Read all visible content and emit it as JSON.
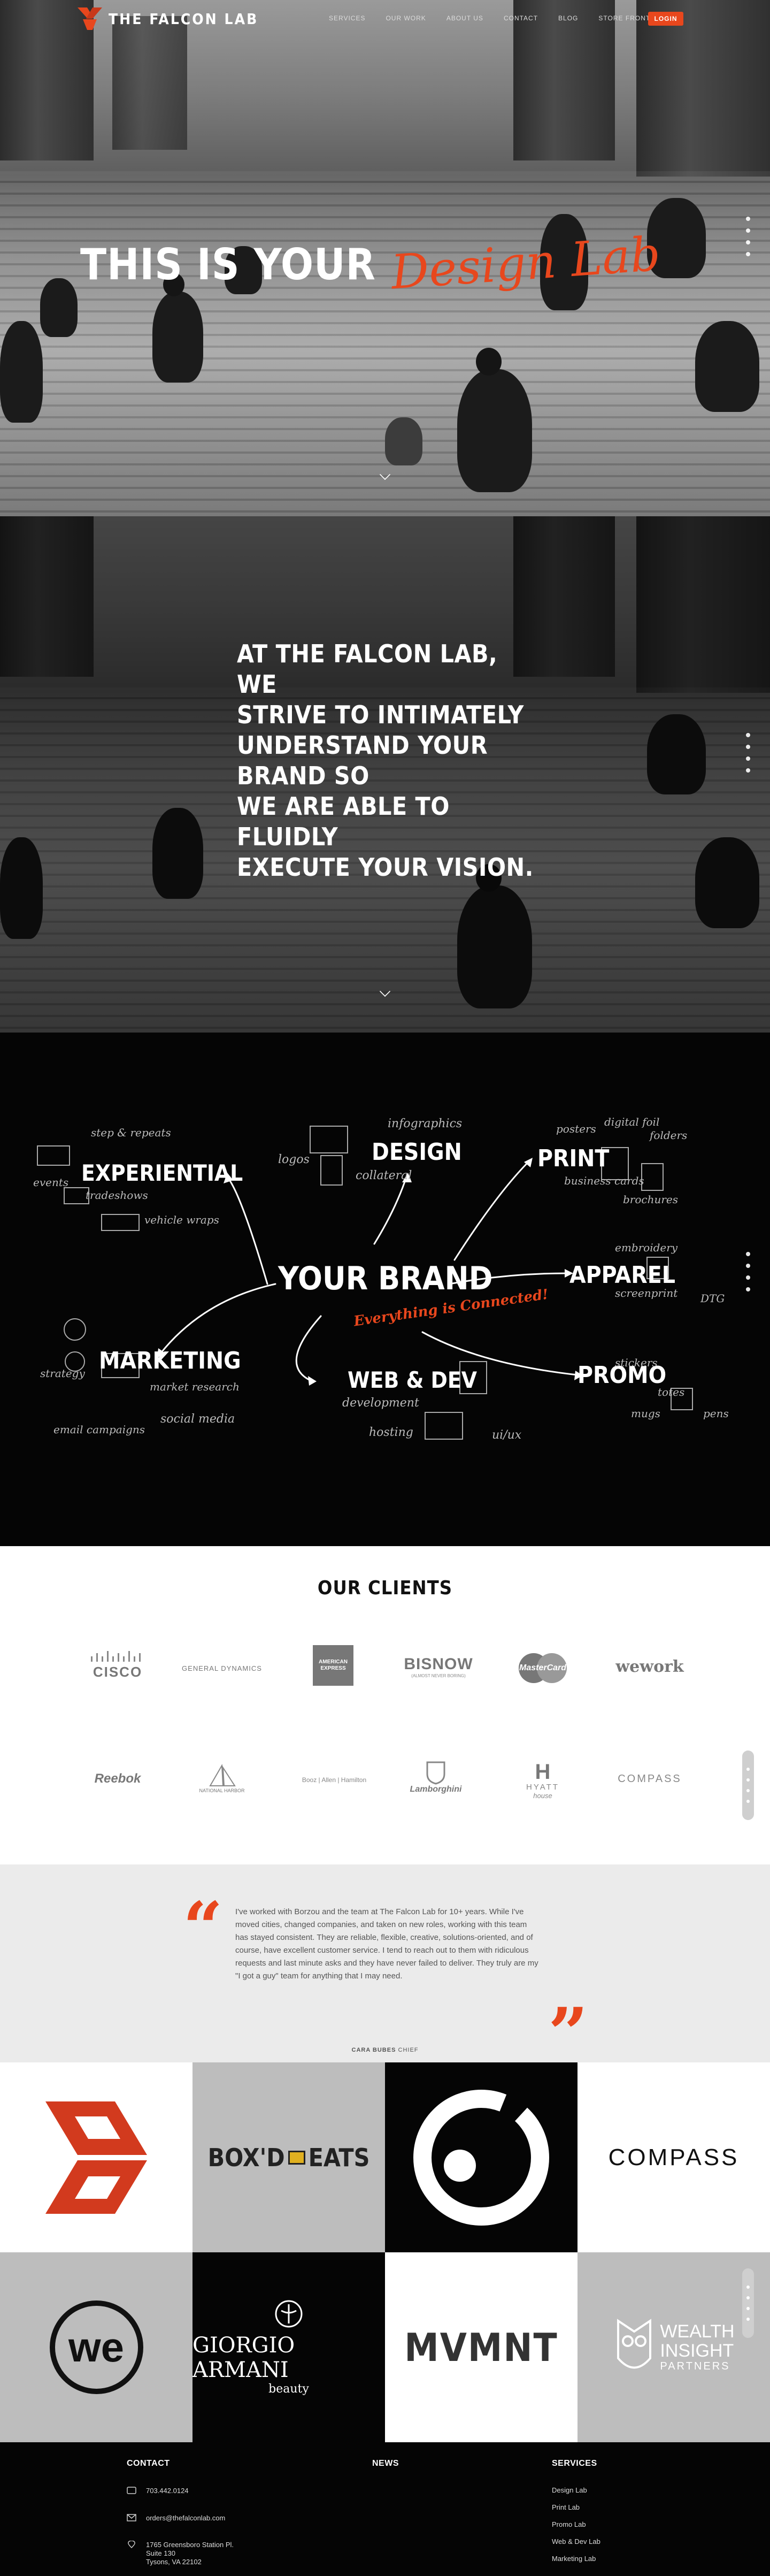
{
  "nav": {
    "logo_text": "THE FALCON LAB",
    "links": [
      "SERVICES",
      "OUR WORK",
      "ABOUT US",
      "CONTACT",
      "BLOG",
      "STORE FRONT"
    ],
    "login": "LOGIN",
    "accent": "#e8471d"
  },
  "hero": {
    "title_plain": "THIS IS YOUR",
    "title_script": "Design Lab"
  },
  "mission": {
    "lines": [
      "AT THE FALCON LAB, WE",
      "STRIVE TO INTIMATELY",
      "UNDERSTAND YOUR BRAND SO",
      "WE ARE ABLE TO FLUIDLY",
      "EXECUTE YOUR VISION."
    ]
  },
  "services_map": {
    "center": "YOUR BRAND",
    "tagline": "Everything is Connected!",
    "experiential": {
      "label": "EXPERIENTIAL",
      "notes": [
        "step & repeats",
        "events",
        "tradeshows",
        "vehicle wraps"
      ]
    },
    "design": {
      "label": "DESIGN",
      "notes": [
        "infographics",
        "logos",
        "collateral"
      ]
    },
    "print": {
      "label": "PRINT",
      "notes": [
        "posters",
        "digital foil",
        "folders",
        "business cards",
        "brochures"
      ]
    },
    "apparel": {
      "label": "APPAREL",
      "notes": [
        "embroidery",
        "screenprint",
        "DTG"
      ]
    },
    "marketing": {
      "label": "MARKETING",
      "notes": [
        "strategy",
        "market research",
        "email campaigns",
        "social media"
      ]
    },
    "webdev": {
      "label": "WEB & DEV",
      "notes": [
        "development",
        "hosting",
        "ui/ux"
      ]
    },
    "promo": {
      "label": "PROMO",
      "notes": [
        "stickers",
        "totes",
        "mugs",
        "pens"
      ]
    }
  },
  "clients": {
    "title": "OUR CLIENTS",
    "row1": [
      "CISCO",
      "GENERAL DYNAMICS",
      "AMERICAN EXPRESS",
      "BISNOW",
      "MasterCard",
      "wework"
    ],
    "bisnow_sub": "(ALMOST NEVER BORING)",
    "row2": [
      "Reebok",
      "NATIONAL HARBOR",
      "Booz | Allen | Hamilton",
      "Lamborghini",
      "HYATT",
      "COMPASS"
    ],
    "hyatt_sub": "house"
  },
  "testimonial": {
    "text": "I've worked with Borzou and the team at The Falcon Lab for 10+ years. While I've moved cities, changed companies, and taken on new roles, working with this team has stayed consistent. They are reliable, flexible, creative, solutions-oriented, and of course, have excellent customer service. I tend to reach out to them with ridiculous requests and last minute asks and they have never failed to deliver. They truly are my \"I got a guy\" team for anything that I may need.",
    "author": "CARA BUBES",
    "author_role": "CHIEF"
  },
  "portfolio": {
    "boxd": "BOX'D",
    "eats": "EATS",
    "compass": "COMPASS",
    "we": "we",
    "armani_1": "GIORGIO ARMANI",
    "armani_2": "beauty",
    "mvmnt": "MVMNT",
    "wealth_1": "WEALTH",
    "wealth_2": "INSIGHT",
    "wealth_3": "PARTNERS"
  },
  "footer": {
    "contact_title": "CONTACT",
    "phone": "703.442.0124",
    "email": "orders@thefalconlab.com",
    "address": [
      "1765 Greensboro Station Pl.",
      "Suite 130",
      "Tysons, VA 22102"
    ],
    "news_title": "NEWS",
    "services_title": "SERVICES",
    "services": [
      "Design Lab",
      "Print Lab",
      "Promo Lab",
      "Web & Dev Lab",
      "Marketing Lab"
    ]
  }
}
